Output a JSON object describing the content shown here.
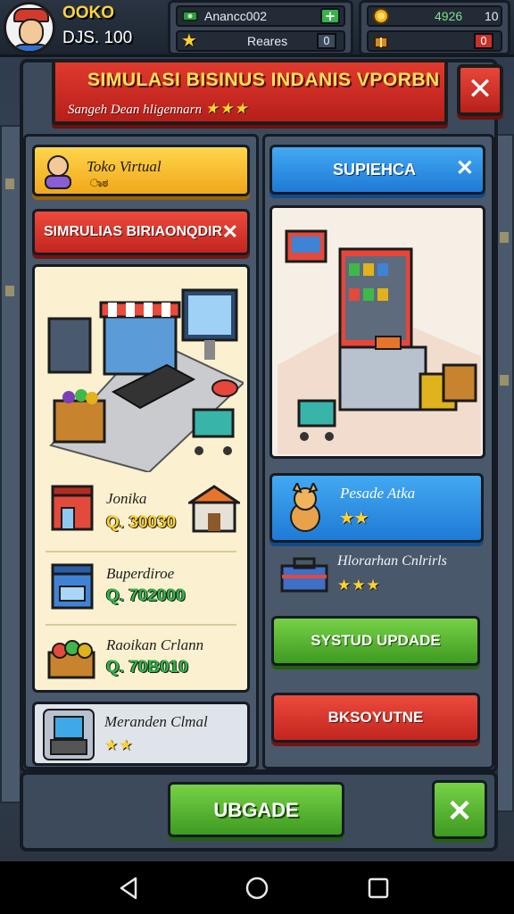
{
  "hud": {
    "player_name": "OOKO",
    "cash": "DJS. 100",
    "panel1_top": "Anancc002",
    "panel1_bottom": "Reares",
    "panel1_badge": "0",
    "panel2_value": "4926",
    "panel2_count": "10",
    "panel2_badge": "0"
  },
  "title": {
    "main": "SIMULASI BISINUS INDANIS VPORBN",
    "subtitle": "Sangeh Dean hligennarn",
    "subtitle_stars": "★★★"
  },
  "left": {
    "toko_button": "Toko Virtual",
    "toko_sub": "ಾಠ",
    "sim_button": "SIMRULIAS BIRIAONQDIR",
    "items": [
      {
        "name": "Jonika",
        "price": "Q. 30030"
      },
      {
        "name": "Buperdiroe",
        "price": "Q. 702000"
      },
      {
        "name": "Raoikan Crlann",
        "price": "Q. 70B010"
      }
    ],
    "bottom_card_name": "Meranden Clmal",
    "bottom_card_stars": "★★"
  },
  "right": {
    "top_button": "SUPIEHCA",
    "pet_name": "Pesade Atka",
    "pet_stars": "★★",
    "item2_name": "Hlorarhan Cnlrirls",
    "item2_stars": "★★★",
    "update_button": "SYSTUD UPDADE",
    "red_button": "BKSOYUTNE"
  },
  "bottom": {
    "main_button": "UBGADE"
  },
  "colors": {
    "accent_red": "#d3302a",
    "accent_green": "#4caf2c",
    "accent_blue": "#2b8ae0",
    "accent_yellow": "#f7c52e"
  }
}
